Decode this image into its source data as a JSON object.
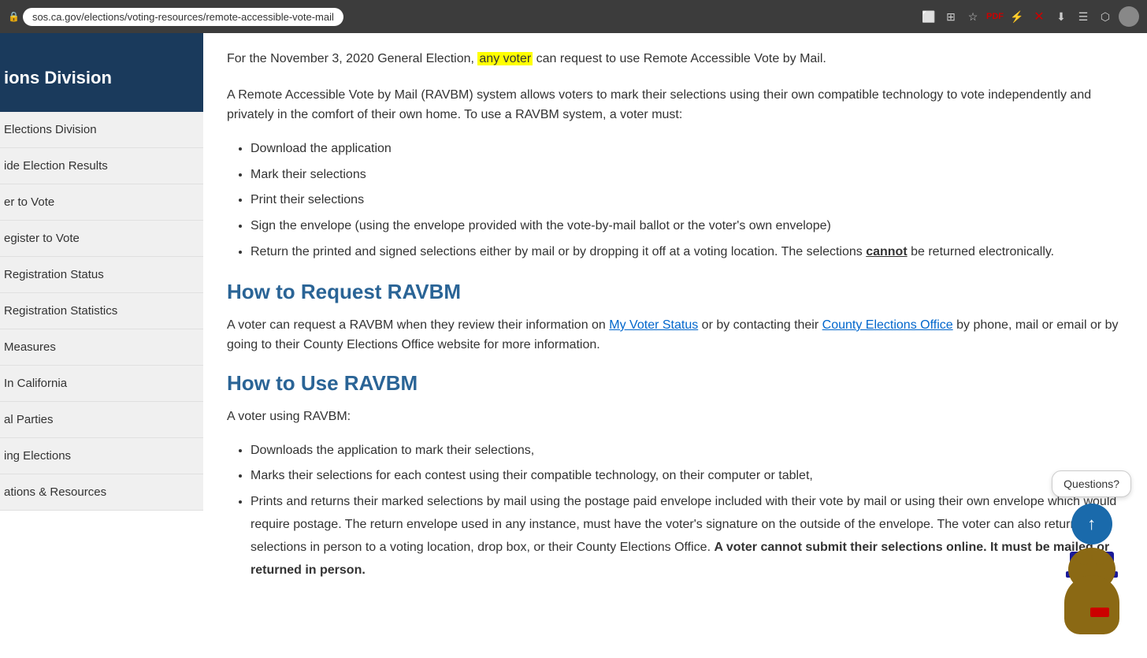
{
  "browser": {
    "url": "sos.ca.gov/elections/voting-resources/remote-accessible-vote-mail",
    "lock_icon": "🔒"
  },
  "sidebar": {
    "header": "ions Division",
    "nav_items": [
      {
        "label": "Elections Division",
        "id": "elections-division"
      },
      {
        "label": "ide Election Results",
        "id": "election-results"
      },
      {
        "label": "er to Vote",
        "id": "register-to-vote"
      },
      {
        "label": "egister to Vote",
        "id": "register-to-vote2"
      },
      {
        "label": "Registration Status",
        "id": "registration-status"
      },
      {
        "label": "Registration Statistics",
        "id": "registration-statistics"
      },
      {
        "label": "Measures",
        "id": "measures"
      },
      {
        "label": "In California",
        "id": "in-california"
      },
      {
        "label": "al Parties",
        "id": "political-parties"
      },
      {
        "label": "ing Elections",
        "id": "upcoming-elections"
      },
      {
        "label": "ations & Resources",
        "id": "publications-resources"
      }
    ]
  },
  "content": {
    "intro_para_before_highlight": "For the November 3, 2020 General Election, ",
    "highlight_text": "any voter",
    "intro_para_after_highlight": " can request to use Remote Accessible Vote by Mail.",
    "system_para": "A Remote Accessible Vote by Mail (RAVBM) system allows voters to mark their selections using their own compatible technology to vote independently and privately in the comfort of their own home. To use a RAVBM system, a voter must:",
    "bullet_items": [
      "Download the application",
      "Mark their selections",
      "Print their selections",
      "Sign the envelope (using the envelope provided with the vote-by-mail ballot or the voter's own envelope)",
      "Return the printed and signed selections either by mail or by dropping it off at a voting location. The selections cannot be returned electronically."
    ],
    "cannot_word": "cannot",
    "section1_heading": "How to Request RAVBM",
    "request_para_before_link1": "A voter can request a RAVBM when they review their information on ",
    "request_link1": "My Voter Status",
    "request_para_middle": " or by contacting their ",
    "request_link2": "County Elections Office",
    "request_para_end": " by phone, mail or email or by going to their County Elections Office website for more information.",
    "section2_heading": "How to Use RAVBM",
    "use_intro": "A voter using RAVBM:",
    "use_bullets": [
      "Downloads the application to mark their selections,",
      "Marks their selections for each contest using their compatible technology, on their computer or tablet,",
      "Prints and returns their marked selections by mail using the postage paid envelope included with their vote by mail or using their own envelope which would require postage. The return envelope used in any instance, must have the voter's signature on the outside of the envelope. The voter can also return their selections in person to a voting location, drop box, or their County Elections Office. A voter cannot submit their selections online. It must be mailed or returned in person."
    ],
    "bold_end_text": "A voter cannot submit their selections online. It must be mailed or returned in person."
  },
  "chatbot": {
    "bubble_text": "Questions?",
    "scroll_arrow": "↑"
  }
}
